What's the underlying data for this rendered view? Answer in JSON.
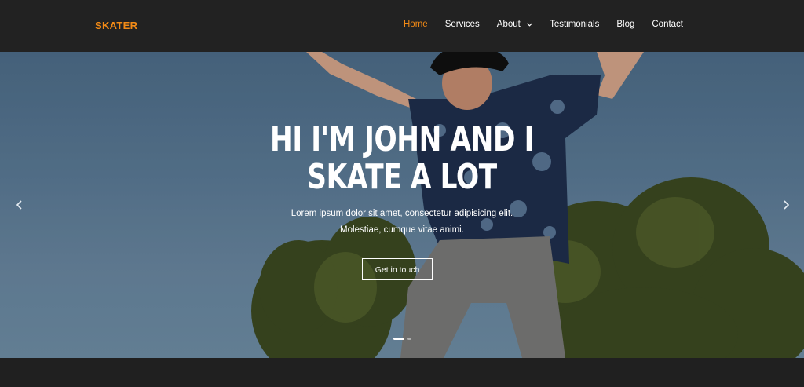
{
  "nav": {
    "brand": "SKATER",
    "items": [
      {
        "label": "Home",
        "active": true
      },
      {
        "label": "Services",
        "active": false
      },
      {
        "label": "About",
        "active": false,
        "dropdown": true,
        "icon": "chevron-down-icon"
      },
      {
        "label": "Testimonials",
        "active": false
      },
      {
        "label": "Blog",
        "active": false
      },
      {
        "label": "Contact",
        "active": false
      }
    ]
  },
  "hero": {
    "headline_line1": "HI I'M JOHN AND I",
    "headline_line2": "SKATE A LOT",
    "sub_line1": "Lorem ipsum dolor sit amet, consectetur adipisicing elit.",
    "sub_line2": "Molestiae, cumque vitae animi.",
    "cta_label": "Get in touch",
    "prev_icon": "chevron-left-icon",
    "next_icon": "chevron-right-icon",
    "slides": 2,
    "active_slide": 1
  },
  "colors": {
    "accent": "#f28a16",
    "nav_bg": "#222222",
    "text": "#ffffff"
  }
}
